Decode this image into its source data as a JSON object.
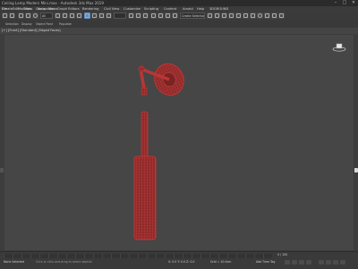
{
  "app": {
    "window_title": "Ceiling Lamp Modern Mini.max - Autodesk 3ds Max 2019"
  },
  "window_controls": {
    "minimize": "–",
    "maximize": "□",
    "close": "✕"
  },
  "menubar": {
    "items": [
      "File",
      "Edit",
      "Tools",
      "Group",
      "Views",
      "Create",
      "Modifiers",
      "Animation",
      "Graph Editors",
      "Rendering",
      "Civil View",
      "Customize",
      "Scripting",
      "Content",
      "Arnold",
      "Help",
      "3DGROUND"
    ]
  },
  "toolbar": {
    "selection_filter": "All",
    "named_selection": "Create Selection Se"
  },
  "toolbar2": {
    "labels": [
      "Selection",
      "Display",
      "Object Paint",
      "Populate"
    ]
  },
  "viewport": {
    "label": "[+] [Front] [Standard] [Edged Faces]"
  },
  "statusbar": {
    "selection_info": "None Selected",
    "prompt": "Click or click-and-drag to select objects",
    "coords": "X: 0.0   Y: 0.0   Z: 0.0",
    "grid": "Grid = 10.0cm",
    "add_time_tag": "Add Time Tag",
    "frame_counter": "0 / 100"
  },
  "colors": {
    "model_wire": "#c23a3a",
    "model_fill": "#8e2b2b",
    "select_accent": "#5b8fc9"
  }
}
